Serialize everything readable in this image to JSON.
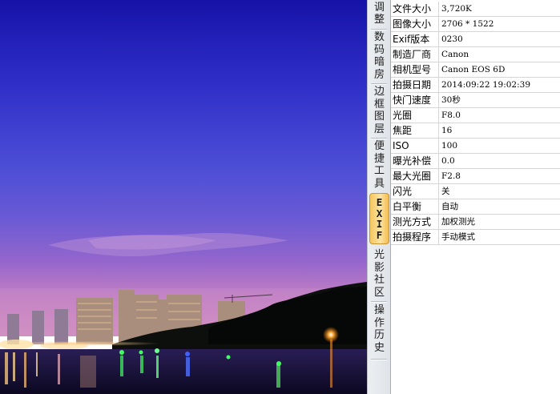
{
  "tabs": [
    {
      "id": "adjust",
      "chars": [
        "调",
        "整"
      ]
    },
    {
      "id": "darkroom",
      "chars": [
        "数",
        "码",
        "暗",
        "房"
      ]
    },
    {
      "id": "border",
      "chars": [
        "边",
        "框",
        "图",
        "层"
      ]
    },
    {
      "id": "tools",
      "chars": [
        "便",
        "捷",
        "工",
        "具"
      ]
    },
    {
      "id": "exif",
      "chars": [
        "E",
        "X",
        "I",
        "F"
      ],
      "active": true
    },
    {
      "id": "community",
      "chars": [
        "光",
        "影",
        "社",
        "区"
      ]
    },
    {
      "id": "history",
      "chars": [
        "操",
        "作",
        "历",
        "史"
      ]
    }
  ],
  "exif": {
    "rows": [
      {
        "key": "文件大小",
        "value": "3,720K"
      },
      {
        "key": "图像大小",
        "value": "2706 * 1522"
      },
      {
        "key": "Exif版本",
        "value": "0230"
      },
      {
        "key": "制造厂商",
        "value": "Canon"
      },
      {
        "key": "相机型号",
        "value": "Canon EOS 6D"
      },
      {
        "key": "拍摄日期",
        "value": "2014:09:22 19:02:39"
      },
      {
        "key": "快门速度",
        "value": "30秒"
      },
      {
        "key": "光圈",
        "value": "F8.0"
      },
      {
        "key": "焦距",
        "value": "16"
      },
      {
        "key": "ISO",
        "value": "100"
      },
      {
        "key": "曝光补偿",
        "value": "0.0"
      },
      {
        "key": "最大光圈",
        "value": "F2.8"
      },
      {
        "key": "闪光",
        "value": "关"
      },
      {
        "key": "白平衡",
        "value": "自动"
      },
      {
        "key": "测光方式",
        "value": "加权测光"
      },
      {
        "key": "拍摄程序",
        "value": "手动模式"
      }
    ]
  },
  "colors": {
    "sky_top": "#1a1ab8",
    "sky_mid": "#4a3fd0",
    "sky_horizon": "#9a5fd0",
    "active_tab": "#f6c65c"
  }
}
